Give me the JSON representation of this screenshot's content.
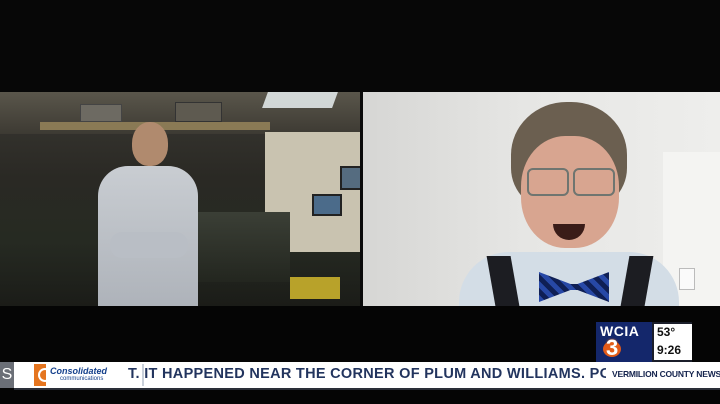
{
  "broadcast": {
    "station_call": "WCIA",
    "station_number": "3",
    "temperature": "53°",
    "time": "9:26"
  },
  "ticker": {
    "left_fragment": "S",
    "sponsor_name": "Consolidated",
    "sponsor_tagline": "communications",
    "headline": "T. IT HAPPENED NEAR THE CORNER OF PLUM AND WILLIAMS. POLICE",
    "region": "VERMILION COUNTY NEWS"
  },
  "colors": {
    "brand_navy": "#14276b",
    "brand_orange": "#e35a1a",
    "ticker_text": "#22345e"
  }
}
